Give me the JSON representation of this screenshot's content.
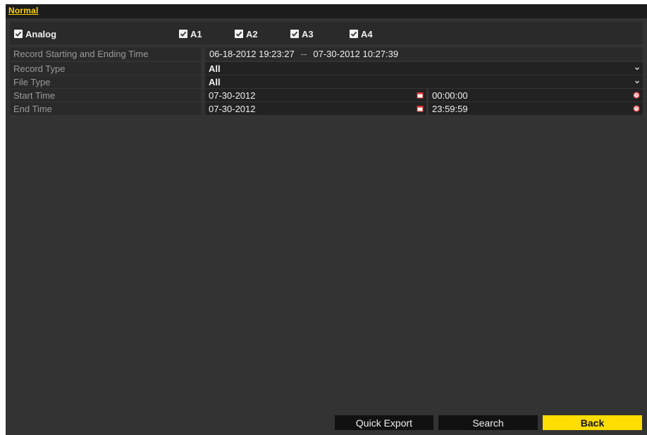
{
  "tabs": [
    {
      "label": "Normal",
      "active": true
    }
  ],
  "channels": {
    "analog": {
      "label": "Analog",
      "checked": true
    },
    "items": [
      {
        "label": "A1",
        "checked": true
      },
      {
        "label": "A2",
        "checked": true
      },
      {
        "label": "A3",
        "checked": true
      },
      {
        "label": "A4",
        "checked": true
      }
    ]
  },
  "record_range": {
    "label": "Record Starting and Ending Time",
    "start": "06-18-2012 19:23:27",
    "separator": "--",
    "end": "07-30-2012 10:27:39"
  },
  "record_type": {
    "label": "Record Type",
    "value": "All"
  },
  "file_type": {
    "label": "File Type",
    "value": "All"
  },
  "start_time": {
    "label": "Start Time",
    "date": "07-30-2012",
    "time": "00:00:00"
  },
  "end_time": {
    "label": "End Time",
    "date": "07-30-2012",
    "time": "23:59:59"
  },
  "buttons": {
    "quick_export": "Quick Export",
    "search": "Search",
    "back": "Back"
  },
  "colors": {
    "accent": "#ffdd00",
    "tab_text": "#ffd200",
    "panel_bg": "#333333",
    "icon_red": "#e0302f"
  },
  "icons": {
    "checkbox": "checkmark-icon",
    "dropdown": "chevron-down-icon",
    "calendar": "calendar-icon",
    "clock": "clock-icon"
  }
}
